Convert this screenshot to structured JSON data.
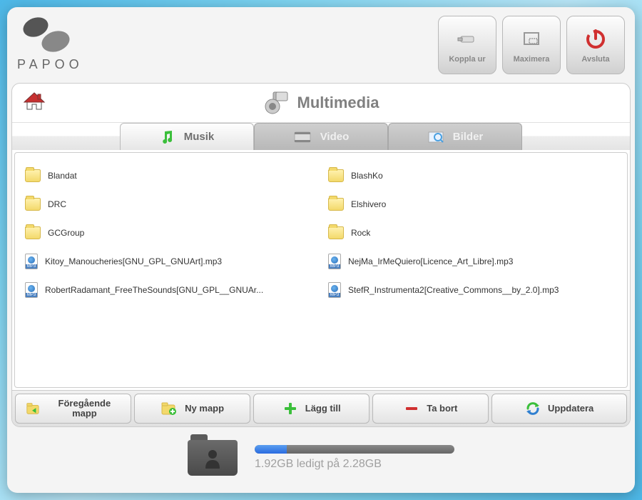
{
  "brand": "PAPOO",
  "header": {
    "buttons": [
      {
        "label": "Koppla ur",
        "icon": "usb-icon"
      },
      {
        "label": "Maximera",
        "icon": "maximize-icon"
      },
      {
        "label": "Avsluta",
        "icon": "power-icon"
      }
    ]
  },
  "page": {
    "title": "Multimedia",
    "tabs": [
      {
        "label": "Musik",
        "active": true
      },
      {
        "label": "Video",
        "active": false
      },
      {
        "label": "Bilder",
        "active": false
      }
    ]
  },
  "files": {
    "col1": [
      {
        "type": "folder",
        "name": "Blandat"
      },
      {
        "type": "folder",
        "name": "DRC"
      },
      {
        "type": "folder",
        "name": "GCGroup"
      },
      {
        "type": "mp3",
        "name": "Kitoy_Manoucheries[GNU_GPL_GNUArt].mp3"
      },
      {
        "type": "mp3",
        "name": "RobertRadamant_FreeTheSounds[GNU_GPL__GNUAr..."
      }
    ],
    "col2": [
      {
        "type": "folder",
        "name": "BlashKo"
      },
      {
        "type": "folder",
        "name": "Elshivero"
      },
      {
        "type": "folder",
        "name": "Rock"
      },
      {
        "type": "mp3",
        "name": "NejMa_IrMeQuiero[Licence_Art_Libre].mp3"
      },
      {
        "type": "mp3",
        "name": "StefR_Instrumenta2[Creative_Commons__by_2.0].mp3"
      }
    ]
  },
  "toolbar": {
    "prev": "Föregående mapp",
    "newfolder": "Ny mapp",
    "add": "Lägg till",
    "remove": "Ta bort",
    "refresh": "Uppdatera"
  },
  "storage": {
    "text": "1.92GB ledigt på 2.28GB",
    "used_percent": 16
  }
}
